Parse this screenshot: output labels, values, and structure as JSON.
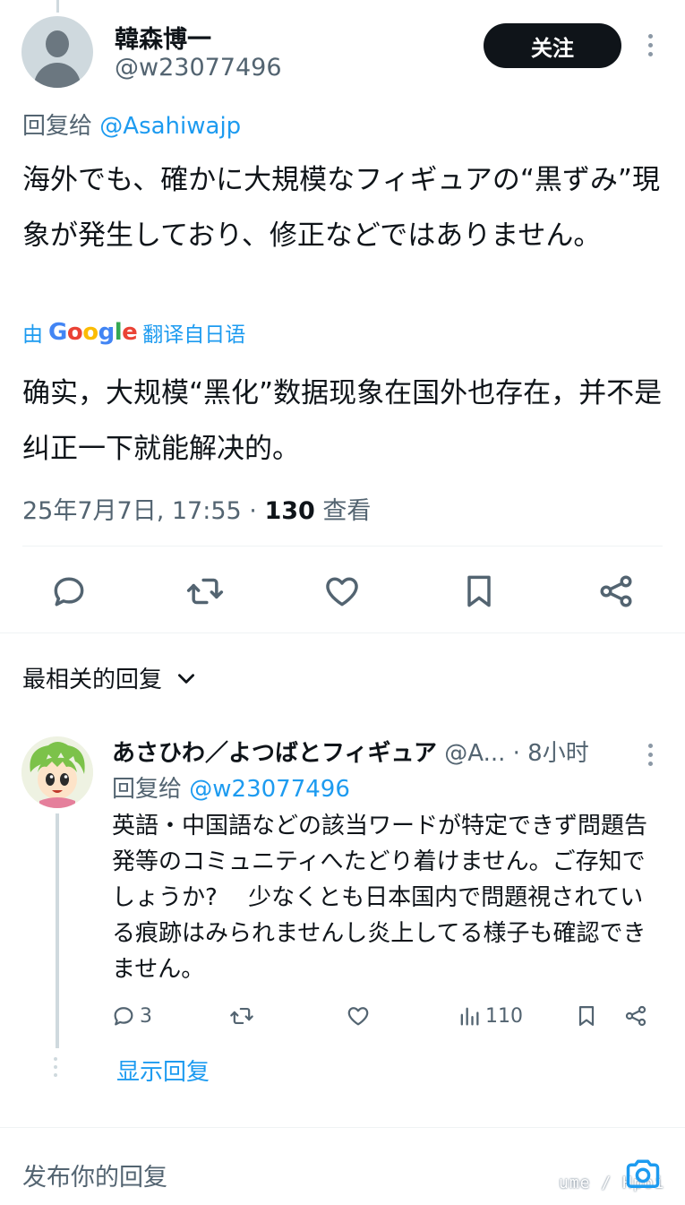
{
  "main_tweet": {
    "display_name": "韓森博一",
    "handle": "@w23077496",
    "follow_label": "关注",
    "reply_to_prefix": "回复给",
    "reply_to_handle": "@Asahiwajp",
    "text": "海外でも、確かに大規模なフィギュアの“黒ずみ”現象が発生しており、修正などではありません。",
    "translate_prefix": "由",
    "translate_brand": "Google",
    "translate_suffix": "翻译自日语",
    "translated_text": "确实，大规模“黑化”数据现象在国外也存在，并不是纠正一下就能解决的。",
    "timestamp": "25年7月7日, 17:55 · ",
    "views_count": "130",
    "views_label": " 查看"
  },
  "sort": {
    "label": "最相关的回复"
  },
  "reply_tweet": {
    "display_name": "あさひわ／よつばとフィギュア",
    "handle": "@A...",
    "time": " · 8小时",
    "reply_to_prefix": "回复给",
    "reply_to_handle": "@w23077496",
    "text": "英語・中国語などの該当ワードが特定できず問題告発等のコミュニティへたどり着けません。ご存知でしょうか?　 少なくとも日本国内で問題視されている痕跡はみられませんし炎上してる様子も確認できません。",
    "reply_count": "3",
    "view_count": "110",
    "show_replies_label": "显示回复"
  },
  "compose": {
    "placeholder": "发布你的回复"
  },
  "watermark": "ume / Hpoi",
  "colors": {
    "accent": "#1d9bf0",
    "text_primary": "#0f1419",
    "text_secondary": "#536471"
  },
  "icons": [
    "reply-icon",
    "retweet-icon",
    "like-icon",
    "bookmark-icon",
    "share-icon",
    "chevron-down-icon",
    "analytics-icon",
    "camera-icon",
    "more-icon"
  ]
}
